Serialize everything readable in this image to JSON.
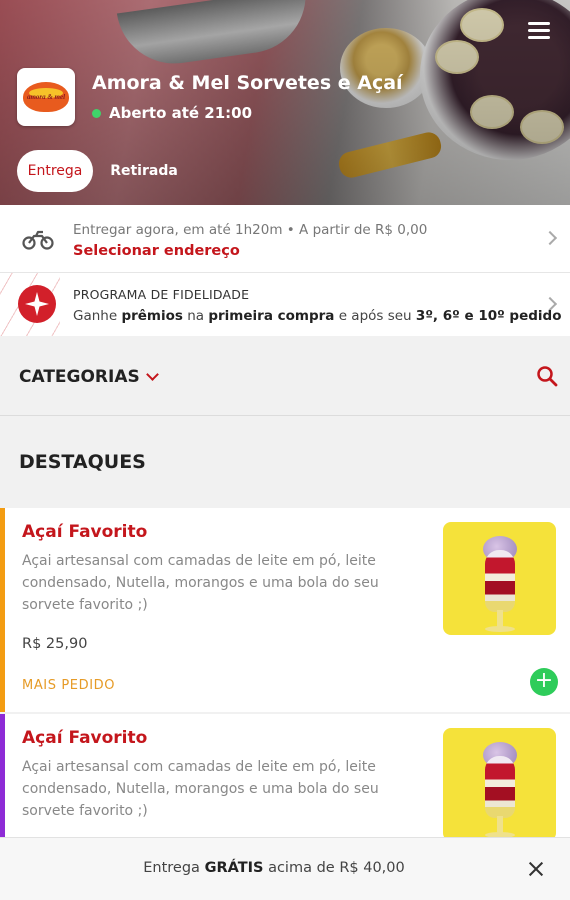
{
  "store": {
    "name": "Amora & Mel Sorvetes e Açaí",
    "logo_text": "amora & mel",
    "status_text": "Aberto até 21:00"
  },
  "tabs": {
    "delivery_label": "Entrega",
    "pickup_label": "Retirada",
    "selected": "Entrega"
  },
  "delivery_info": {
    "line1": "Entregar agora, em até 1h20m  •  A partir de R$ 0,00",
    "select_address": "Selecionar endereço"
  },
  "loyalty": {
    "title": "PROGRAMA DE FIDELIDADE",
    "text_1": "Ganhe ",
    "text_2": "prêmios",
    "text_3": " na ",
    "text_4": "primeira compra",
    "text_5": " e após seu ",
    "text_6": "3º, 6º e 10º pedido"
  },
  "categories": {
    "label": "CATEGORIAS"
  },
  "section": {
    "title": "DESTAQUES"
  },
  "products": [
    {
      "title": "Açaí Favorito",
      "description": "Açai artesansal com camadas de leite em pó, leite condensado, Nutella, morangos e uma bola do seu sorvete favorito ;)",
      "price": "R$ 25,90",
      "tag": "MAIS PEDIDO"
    },
    {
      "title": "Açaí Favorito",
      "description": "Açai artesansal com camadas de leite em pó, leite condensado, Nutella, morangos e uma bola do seu sorvete favorito ;)"
    }
  ],
  "add_button": "+",
  "footer": {
    "text_1": "Entrega ",
    "text_2": "GRÁTIS",
    "text_3": " acima de R$ 40,00"
  },
  "colors": {
    "brand_red": "#c4161c",
    "open_green": "#3fd46a",
    "add_green": "#2ecc5a",
    "tag_orange": "#e69b27",
    "card1_accent": "#f39c12",
    "card2_accent": "#8e2bd6"
  },
  "icons": [
    "menu-icon",
    "motorcycle-icon",
    "chevron-right-icon",
    "loyalty-star-icon",
    "chevron-down-icon",
    "search-icon",
    "plus-icon",
    "close-icon"
  ]
}
